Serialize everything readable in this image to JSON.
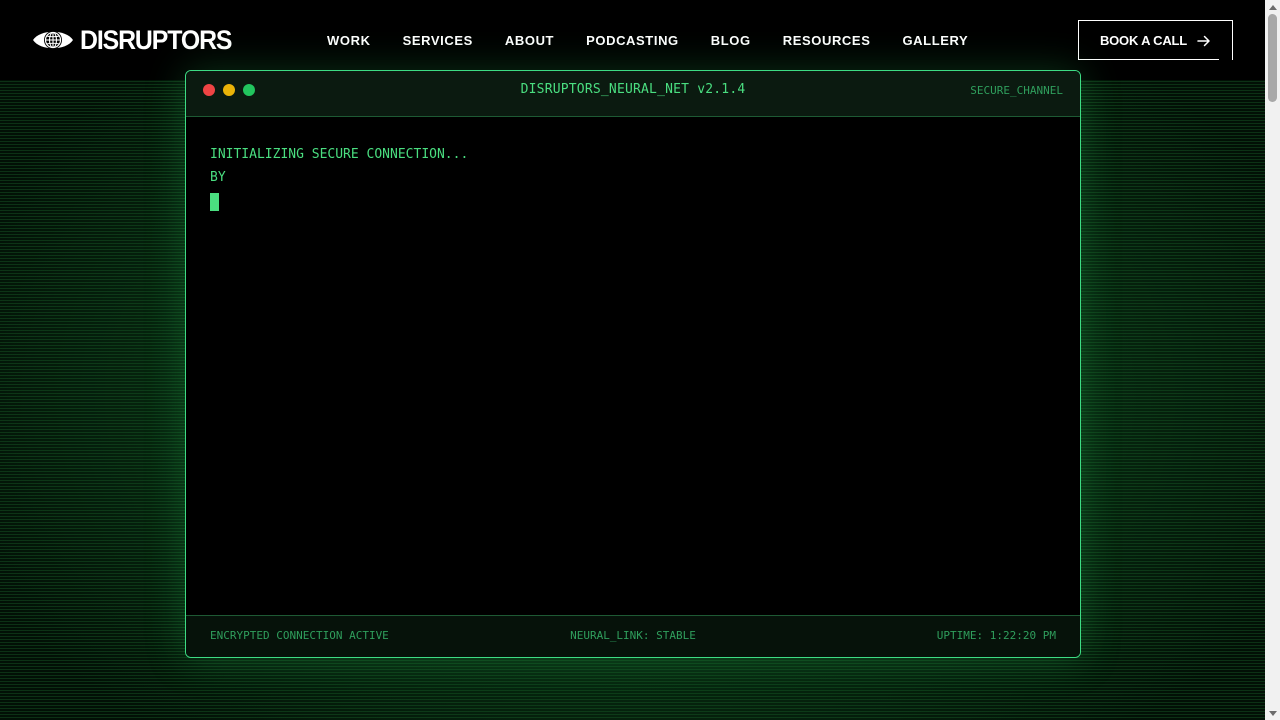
{
  "brand": {
    "name": "DISRUPTORS",
    "logo_icon": "eye-globe-icon"
  },
  "nav": {
    "items": [
      {
        "label": "WORK"
      },
      {
        "label": "SERVICES"
      },
      {
        "label": "ABOUT"
      },
      {
        "label": "PODCASTING"
      },
      {
        "label": "BLOG"
      },
      {
        "label": "RESOURCES"
      },
      {
        "label": "GALLERY"
      }
    ],
    "cta_label": "BOOK A CALL",
    "cta_icon": "arrow-right-icon"
  },
  "terminal": {
    "title": "DISRUPTORS_NEURAL_NET v2.1.4",
    "channel": "SECURE_CHANNEL",
    "lines": [
      "INITIALIZING SECURE CONNECTION...",
      "BY"
    ],
    "footer": {
      "left": "ENCRYPTED CONNECTION ACTIVE",
      "center": "NEURAL_LINK: STABLE",
      "right": "UPTIME: 1:22:20 PM"
    }
  },
  "colors": {
    "accent_green": "#4ade80",
    "border_green": "#3ddc84",
    "dot_red": "#ef4444",
    "dot_yellow": "#eab308",
    "dot_green": "#22c55e",
    "background": "#021006"
  }
}
